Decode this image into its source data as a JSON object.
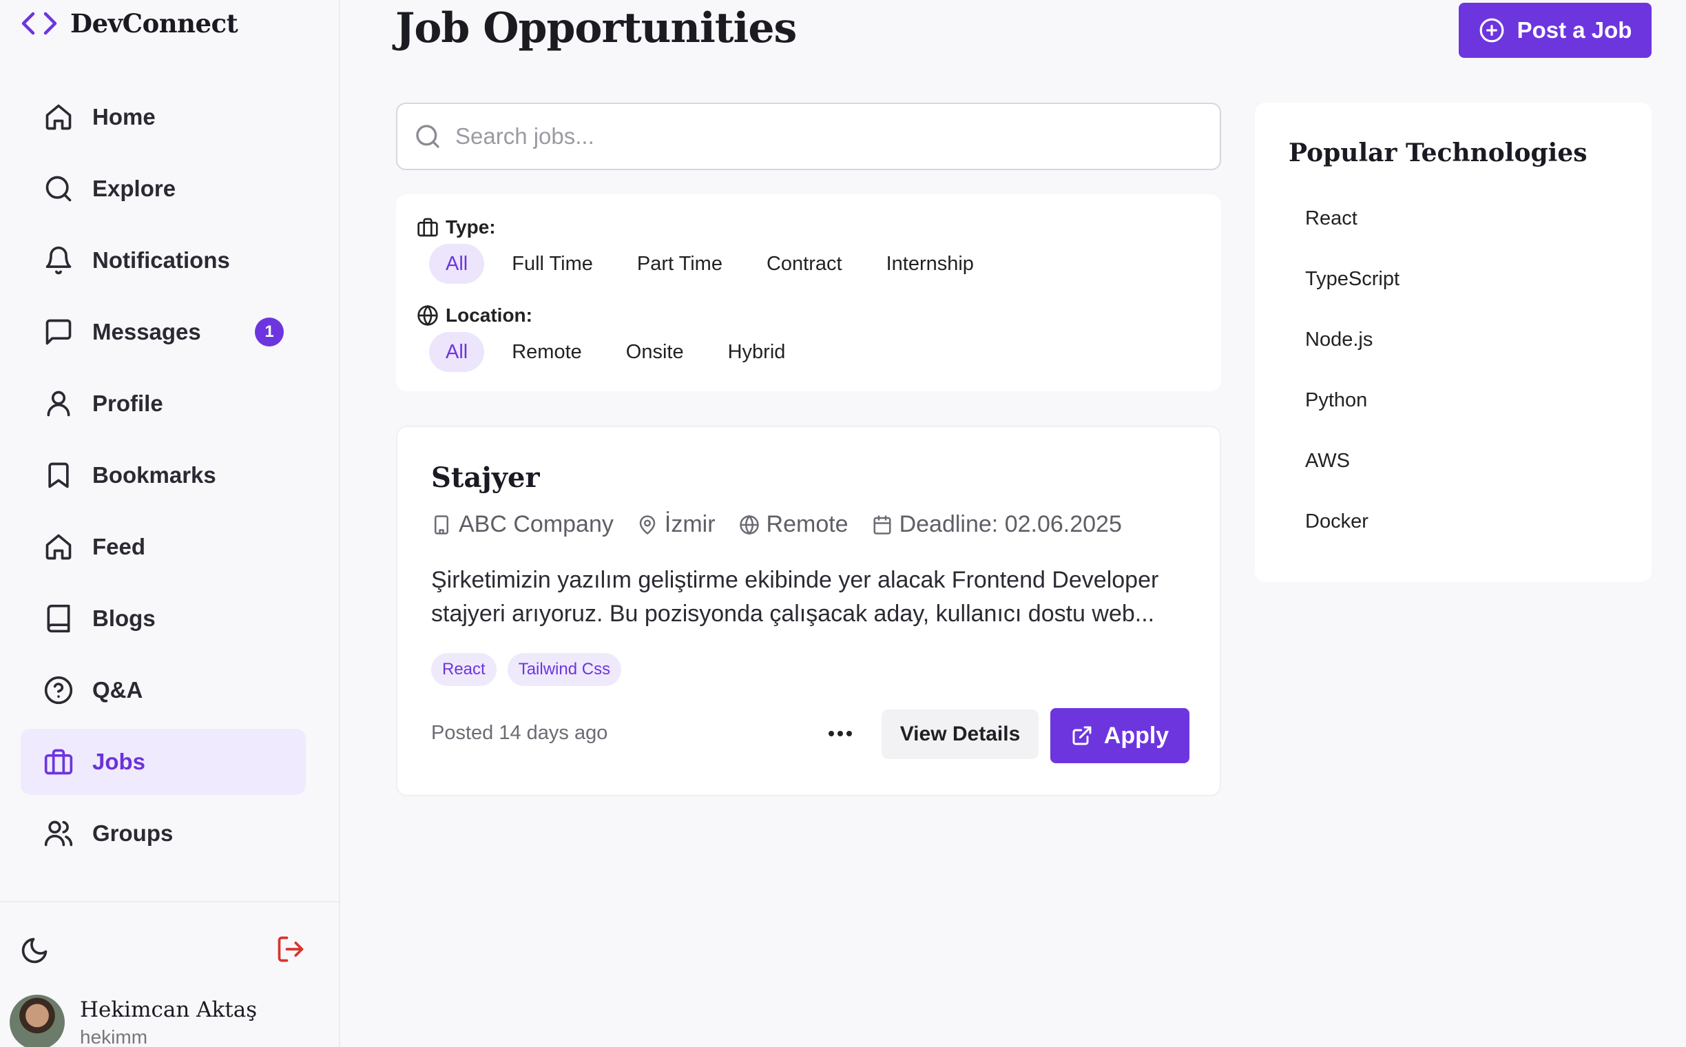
{
  "brand": {
    "name": "DevConnect",
    "logo_icon": "code-brackets-icon",
    "accent": "#6d35de"
  },
  "sidebar": {
    "items": [
      {
        "label": "Home",
        "icon": "home-icon"
      },
      {
        "label": "Explore",
        "icon": "search-icon"
      },
      {
        "label": "Notifications",
        "icon": "bell-icon"
      },
      {
        "label": "Messages",
        "icon": "message-icon",
        "badge": "1"
      },
      {
        "label": "Profile",
        "icon": "user-icon"
      },
      {
        "label": "Bookmarks",
        "icon": "bookmark-icon"
      },
      {
        "label": "Feed",
        "icon": "home-icon"
      },
      {
        "label": "Blogs",
        "icon": "book-icon"
      },
      {
        "label": "Q&A",
        "icon": "help-circle-icon"
      },
      {
        "label": "Jobs",
        "icon": "briefcase-icon",
        "active": true
      },
      {
        "label": "Groups",
        "icon": "users-icon"
      }
    ],
    "user": {
      "name": "Hekimcan Aktaş",
      "handle": "hekimm"
    }
  },
  "page": {
    "title": "Job Opportunities",
    "post_job_label": "Post a Job",
    "search_placeholder": "Search jobs..."
  },
  "filters": {
    "type_label": "Type:",
    "type_options": [
      "All",
      "Full Time",
      "Part Time",
      "Contract",
      "Internship"
    ],
    "type_selected": "All",
    "location_label": "Location:",
    "location_options": [
      "All",
      "Remote",
      "Onsite",
      "Hybrid"
    ],
    "location_selected": "All"
  },
  "job": {
    "title": "Stajyer",
    "company": "ABC Company",
    "location": "İzmir",
    "work_mode": "Remote",
    "deadline": "Deadline: 02.06.2025",
    "description_line1": "Şirketimizin yazılım geliştirme ekibinde yer alacak Frontend Developer",
    "description_line2": "stajyeri arıyoruz. Bu pozisyonda çalışacak aday, kullanıcı dostu web...",
    "tags": [
      "React",
      "Tailwind Css"
    ],
    "posted": "Posted 14 days ago",
    "view_details_label": "View Details",
    "apply_label": "Apply"
  },
  "technologies": {
    "title": "Popular Technologies",
    "items": [
      "React",
      "TypeScript",
      "Node.js",
      "Python",
      "AWS",
      "Docker"
    ]
  }
}
